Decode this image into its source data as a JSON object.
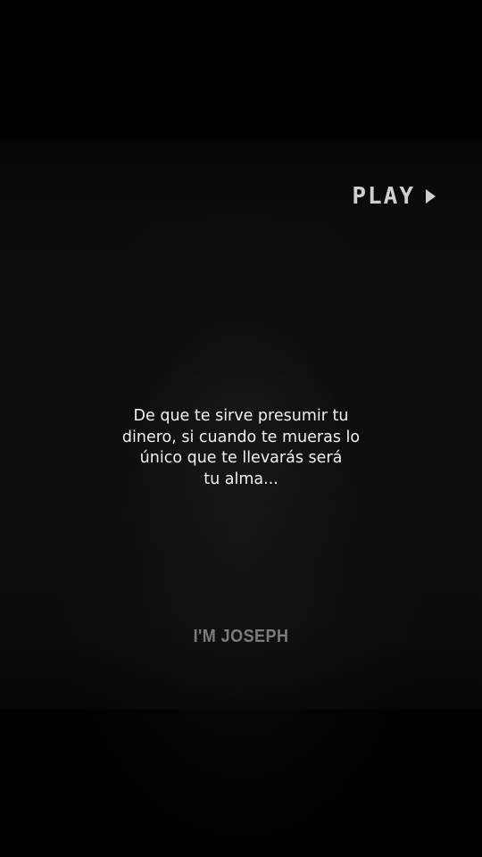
{
  "player": {
    "status_label": "PLAY",
    "status_icon": "play-triangle-icon"
  },
  "quote": {
    "lines": [
      "De que te sirve presumir tu",
      "dinero, si cuando te mueras lo",
      "único que te llevarás será",
      "tu alma..."
    ]
  },
  "signature": "I'M JOSEPH",
  "colors": {
    "background": "#000000",
    "text": "#f2f2f2",
    "play_label": "#cfcfcf",
    "signature": "#7c7c7c"
  }
}
